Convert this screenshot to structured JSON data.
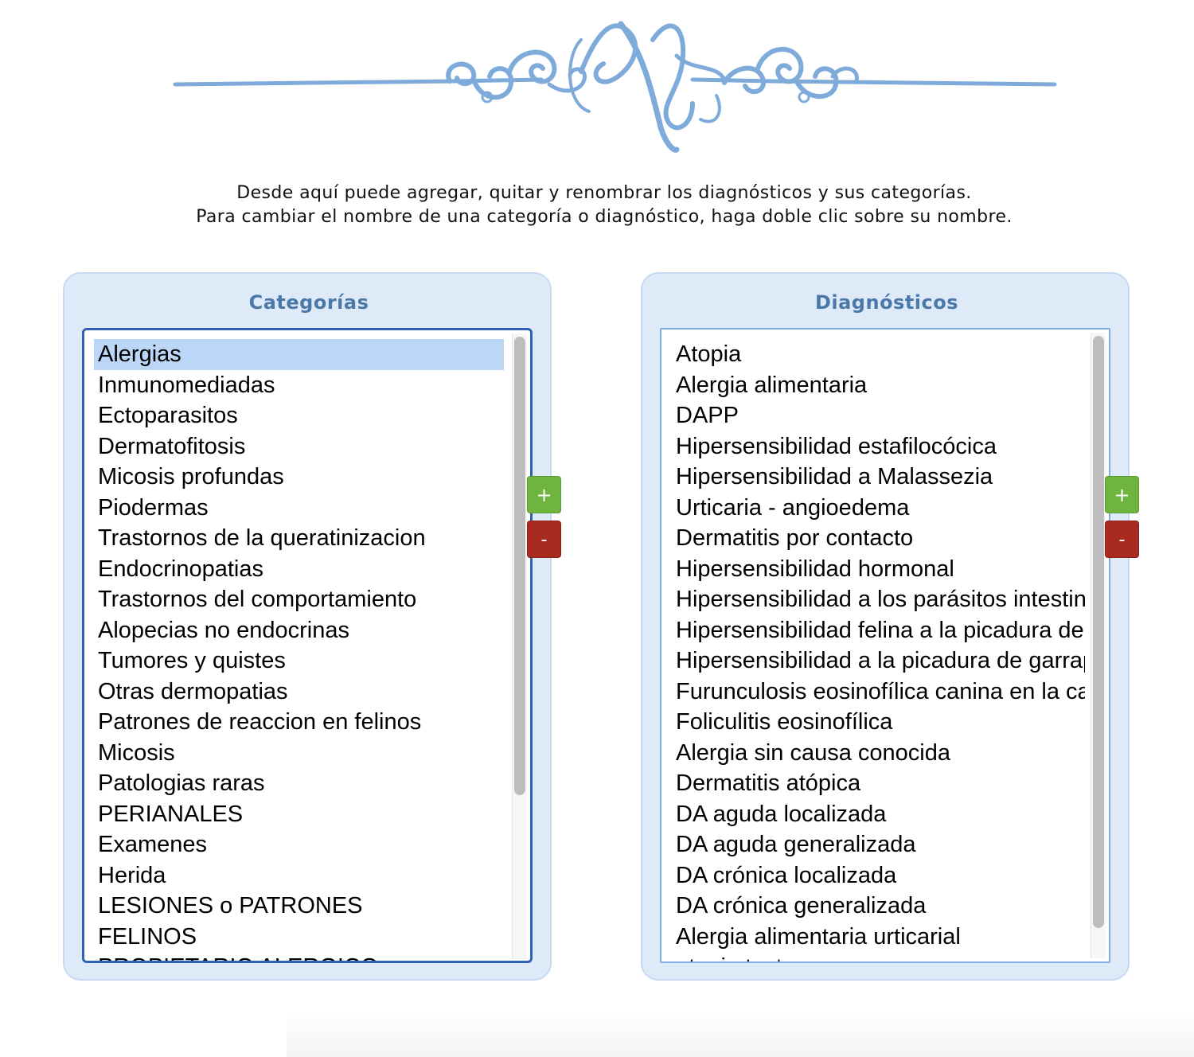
{
  "intro": {
    "line1": "Desde aquí puede agregar, quitar y renombrar los diagnósticos y sus categorías.",
    "line2": "Para cambiar el nombre de una categoría o diagnóstico, haga doble clic sobre su nombre."
  },
  "categorias": {
    "title": "Categorías",
    "selected": "Alergias",
    "items": [
      "Alergias",
      "Inmunomediadas",
      "Ectoparasitos",
      "Dermatofitosis",
      "Micosis profundas",
      "Piodermas",
      "Trastornos de la queratinizacion",
      "Endocrinopatias",
      "Trastornos del comportamiento",
      "Alopecias no endocrinas",
      "Tumores y quistes",
      "Otras dermopatias",
      "Patrones de reaccion en felinos",
      "Micosis",
      "Patologias raras",
      "PERIANALES",
      "Examenes",
      "Herida",
      "LESIONES o PATRONES",
      "FELINOS",
      "PROPIETARIO ALERGICO"
    ],
    "add_label": "+",
    "remove_label": "-"
  },
  "diagnosticos": {
    "title": "Diagnósticos",
    "items": [
      "Atopia",
      "Alergia alimentaria",
      "DAPP",
      "Hipersensibilidad estafilocócica",
      "Hipersensibilidad a Malassezia",
      "Urticaria - angioedema",
      "Dermatitis por contacto",
      "Hipersensibilidad hormonal",
      "Hipersensibilidad a los parásitos intestinales",
      "Hipersensibilidad felina a la picadura de mosquito",
      "Hipersensibilidad a la picadura de garrapata",
      "Furunculosis eosinofílica canina en la cara",
      "Foliculitis eosinofílica",
      "Alergia sin causa conocida",
      "Dermatitis atópica",
      "DA aguda localizada",
      "DA aguda generalizada",
      "DA crónica localizada",
      "DA crónica generalizada",
      "Alergia alimentaria urticarial",
      "atopia test"
    ],
    "add_label": "+",
    "remove_label": "-"
  },
  "colors": {
    "panel_bg": "#dfeaf9",
    "title": "#4a78a8",
    "selection": "#bcd6f8",
    "add": "#6fb43f",
    "remove": "#a92a1e",
    "ornament": "#7fabdb"
  }
}
